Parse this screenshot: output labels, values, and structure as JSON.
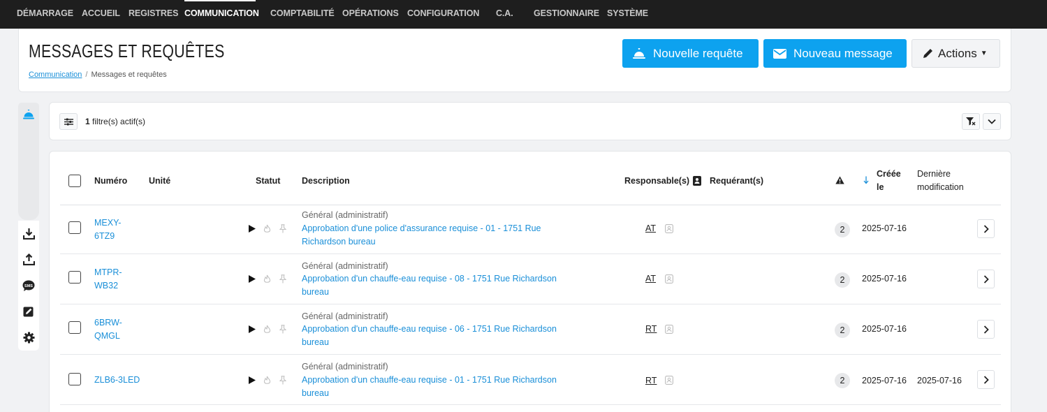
{
  "nav": {
    "items": [
      "DÉMARRAGE",
      "ACCUEIL",
      "REGISTRES",
      "COMMUNICATION",
      "COMPTABILITÉ",
      "OPÉRATIONS",
      "CONFIGURATION",
      "C.A.",
      "GESTIONNAIRE",
      "SYSTÈME"
    ],
    "active": "COMMUNICATION"
  },
  "header": {
    "title": "MESSAGES ET REQUÊTES",
    "breadcrumb": {
      "link": "Communication",
      "separator": "/",
      "current": "Messages et requêtes"
    },
    "buttons": {
      "new_request": "Nouvelle requête",
      "new_message": "Nouveau message",
      "actions": "Actions"
    }
  },
  "filters": {
    "count": "1",
    "label": "filtre(s) actif(s)"
  },
  "table": {
    "columns": {
      "number": "Numéro",
      "unit": "Unité",
      "status": "Statut",
      "description": "Description",
      "responsible": "Responsable(s)",
      "requester": "Requérant(s)",
      "created_line1": "Créée",
      "created_line2": "le",
      "modified_line1": "Dernière",
      "modified_line2": "modification"
    },
    "rows": [
      {
        "number_line1": "MEXY-",
        "number_line2": "6TZ9",
        "category": "Général (administratif)",
        "description": "Approbation d'une police d'assurance requise - 01 - 1751 Rue Richardson bureau",
        "responsible": "AT",
        "count": "2",
        "created": "2025-07-16",
        "modified": ""
      },
      {
        "number_line1": "MTPR-",
        "number_line2": "WB32",
        "category": "Général (administratif)",
        "description": "Approbation d'un chauffe-eau requise - 08 - 1751 Rue Richardson bureau",
        "responsible": "AT",
        "count": "2",
        "created": "2025-07-16",
        "modified": ""
      },
      {
        "number_line1": "6BRW-",
        "number_line2": "QMGL",
        "category": "Général (administratif)",
        "description": "Approbation d'un chauffe-eau requise - 06 - 1751 Rue Richardson bureau",
        "responsible": "RT",
        "count": "2",
        "created": "2025-07-16",
        "modified": ""
      },
      {
        "number_line1": "ZLB6-3LED",
        "number_line2": "",
        "category": "Général (administratif)",
        "description": "Approbation d'un chauffe-eau requise - 01 - 1751 Rue Richardson bureau",
        "responsible": "RT",
        "count": "2",
        "created": "2025-07-16",
        "modified": "2025-07-16"
      }
    ]
  },
  "colors": {
    "accent": "#0da2ef",
    "link": "#1a8fd8",
    "nav_bg": "#1e1e1e"
  }
}
